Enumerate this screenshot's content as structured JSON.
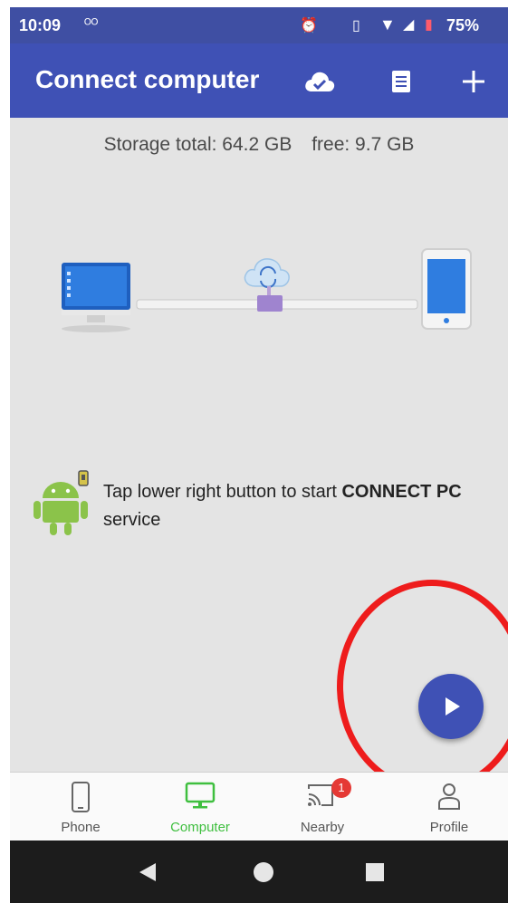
{
  "status_bar": {
    "time": "10:09",
    "voicemail_icon": "voicemail-icon",
    "alarm_icon": "alarm-icon",
    "vibrate_icon": "vibrate-icon",
    "wifi_icon": "wifi-icon",
    "signal_icon": "signal-icon",
    "battery_icon": "battery-icon",
    "battery_percent": "75%"
  },
  "app_bar": {
    "title": "Connect computer",
    "actions": [
      "cloud-check-icon",
      "list-icon",
      "add-icon"
    ]
  },
  "storage": {
    "total": "Storage total: 64.2 GB",
    "free": "free: 9.7 GB"
  },
  "hint": {
    "prefix": "Tap lower right button to start ",
    "bold1": "CONNECT",
    "bold2": "PC",
    "suffix": " service"
  },
  "fab": {
    "icon": "play-icon"
  },
  "bottom_nav": {
    "items": [
      {
        "label": "Phone",
        "icon": "phone-icon",
        "active": false
      },
      {
        "label": "Computer",
        "icon": "monitor-icon",
        "active": true
      },
      {
        "label": "Nearby",
        "icon": "cast-icon",
        "active": false,
        "badge": "1"
      },
      {
        "label": "Profile",
        "icon": "person-icon",
        "active": false
      }
    ]
  },
  "system_nav": [
    "back-icon",
    "home-icon",
    "recents-icon"
  ],
  "colors": {
    "primary": "#3f51b5",
    "active_tab": "#3fbf3f",
    "highlight_circle": "#ee1c1c",
    "background": "#e4e4e4"
  }
}
